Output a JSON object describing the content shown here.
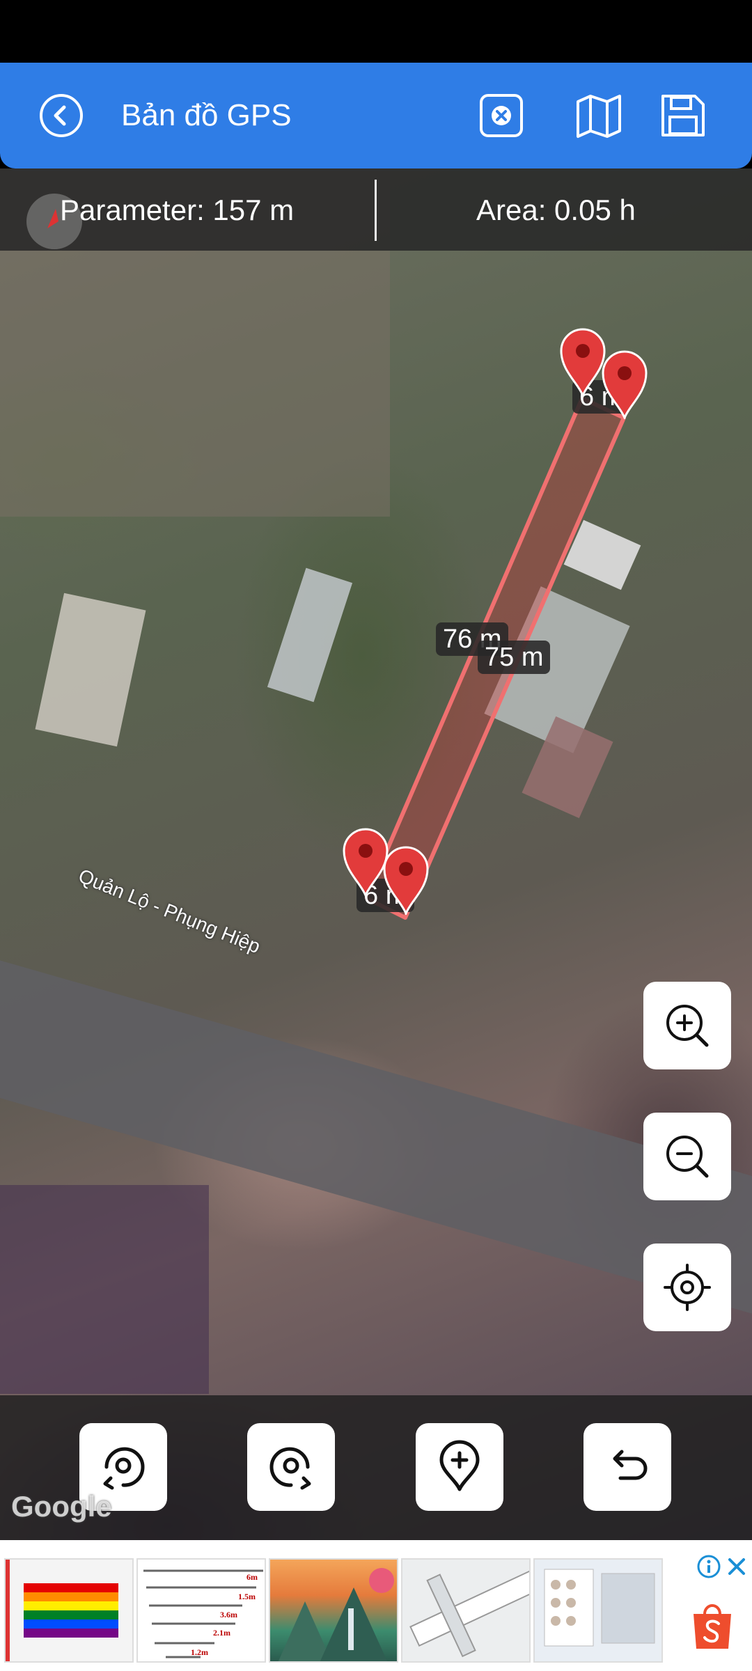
{
  "header": {
    "title": "Bản đồ GPS",
    "back_icon": "chevron-left-circle-icon",
    "clear_icon": "close-square-icon",
    "map_type_icon": "map-icon",
    "save_icon": "floppy-disk-icon",
    "background_color": "#2f7de6"
  },
  "info_bar": {
    "perimeter": "Parameter: 157 m",
    "area": "Area: 0.05 h"
  },
  "map": {
    "road_label": "Quản Lộ - Phụng Hiệp",
    "attribution": "Google",
    "polygon_color": "#e25b5b",
    "pin_color": "#e23b3b",
    "segment_labels": [
      {
        "text": "6 m",
        "side": "top"
      },
      {
        "text": "76 m",
        "side": "left"
      },
      {
        "text": "75 m",
        "side": "right"
      },
      {
        "text": "6 m",
        "side": "bottom"
      }
    ],
    "zoom_in_icon": "zoom-in-icon",
    "zoom_out_icon": "zoom-out-icon",
    "locate_icon": "crosshair-icon"
  },
  "toolbar": {
    "buttons": [
      {
        "icon": "rotate-left-location-icon"
      },
      {
        "icon": "rotate-right-location-icon"
      },
      {
        "icon": "add-location-pin-icon"
      },
      {
        "icon": "undo-icon"
      }
    ]
  },
  "ad": {
    "thumbnails": [
      {
        "label": "rainbow-flag"
      },
      {
        "label": "poles"
      },
      {
        "label": "landscape-painting"
      },
      {
        "label": "ruler"
      },
      {
        "label": "photo-collage"
      }
    ],
    "size_labels": [
      "6m",
      "1.5m",
      "3.6m",
      "2.1m",
      "1.2m"
    ],
    "brand_icon": "shopee-bag-icon"
  }
}
